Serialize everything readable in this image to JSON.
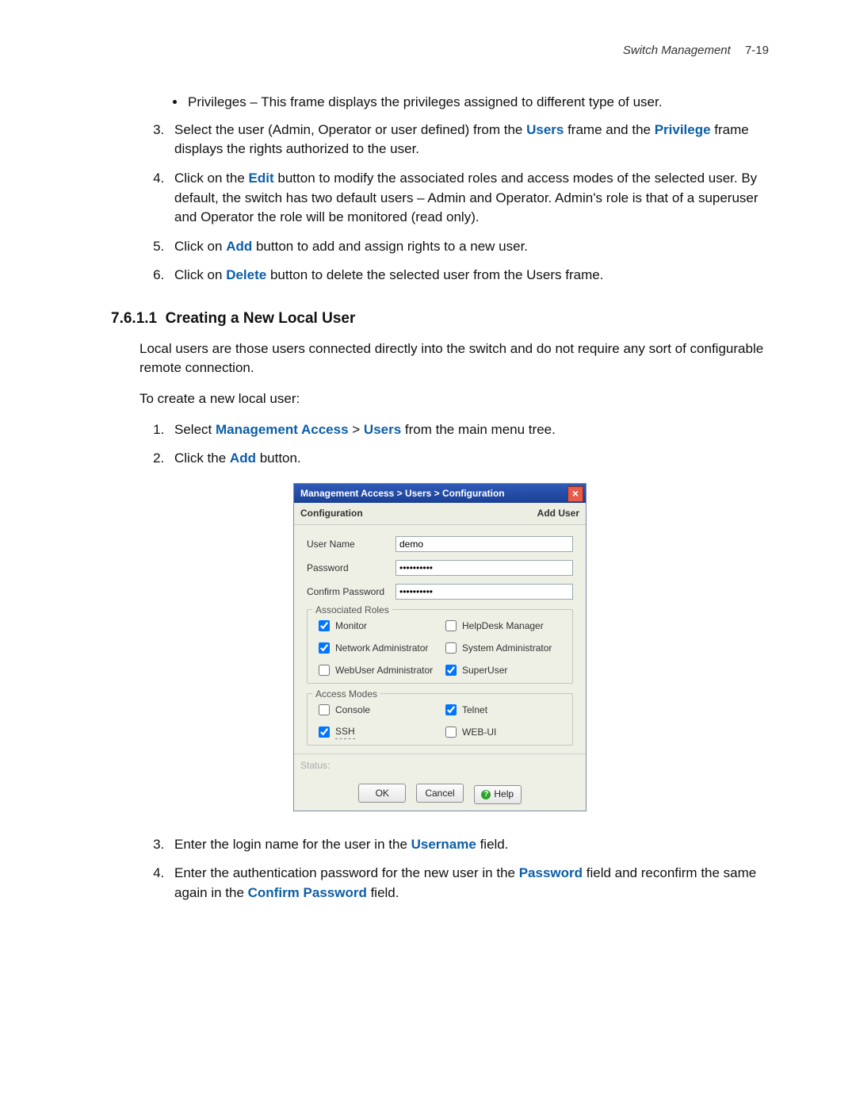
{
  "header": {
    "chapter": "Switch Management",
    "page": "7-19"
  },
  "bullets": [
    "Privileges – This frame displays the privileges assigned to different type of user."
  ],
  "topSteps": {
    "start": 3,
    "items": [
      {
        "pre": "Select the user (Admin, Operator or user defined) from the ",
        "b1": "Users",
        "mid": " frame and the ",
        "b2": "Privilege",
        "post": " frame displays the rights authorized to the user."
      },
      {
        "pre": "Click on the ",
        "b1": "Edit",
        "post": " button to modify the associated roles and access modes of the selected user. By default, the switch has two default users – Admin and Operator. Admin's role is that of a superuser and Operator the role will be monitored (read only)."
      },
      {
        "pre": "Click on ",
        "b1": "Add",
        "post": " button to add and assign rights to a new user."
      },
      {
        "pre": "Click on ",
        "b1": "Delete",
        "post": " button to delete the selected user from the Users frame."
      }
    ]
  },
  "section": {
    "num": "7.6.1.1",
    "title": "Creating a New Local User"
  },
  "intro": "Local users are those users connected directly into the switch and do not require any sort of configurable remote connection.",
  "lead": "To create a new local user:",
  "stepsA": [
    {
      "pre": "Select ",
      "b1": "Management Access",
      "sep": " > ",
      "b2": "Users",
      "post": " from the main menu tree."
    },
    {
      "pre": "Click the ",
      "b1": "Add",
      "post": " button."
    }
  ],
  "dialog": {
    "title": "Management Access > Users > Configuration",
    "tabLeft": "Configuration",
    "tabRight": "Add User",
    "fields": {
      "userLabel": "User Name",
      "userValue": "demo",
      "passLabel": "Password",
      "passValue": "**********",
      "confirmLabel": "Confirm Password",
      "confirmValue": "**********"
    },
    "roles": {
      "legend": "Associated Roles",
      "items": [
        {
          "label": "Monitor",
          "checked": true
        },
        {
          "label": "HelpDesk Manager",
          "checked": false
        },
        {
          "label": "Network Administrator",
          "checked": true
        },
        {
          "label": "System Administrator",
          "checked": false
        },
        {
          "label": "WebUser Administrator",
          "checked": false
        },
        {
          "label": "SuperUser",
          "checked": true
        }
      ]
    },
    "modes": {
      "legend": "Access Modes",
      "items": [
        {
          "label": "Console",
          "checked": false,
          "dashed": false
        },
        {
          "label": "Telnet",
          "checked": true,
          "dashed": false
        },
        {
          "label": "SSH",
          "checked": true,
          "dashed": true
        },
        {
          "label": "WEB-UI",
          "checked": false,
          "dashed": false
        }
      ]
    },
    "status": "Status:",
    "buttons": {
      "ok": "OK",
      "cancel": "Cancel",
      "help": "Help"
    }
  },
  "stepsB": {
    "start": 3,
    "items": [
      {
        "pre": "Enter the login name for the user in the ",
        "b1": "Username",
        "post": " field."
      },
      {
        "pre": "Enter the authentication password for the new user in the ",
        "b1": "Password",
        "mid": " field and reconfirm the same again in the ",
        "b2": "Confirm Password",
        "post": " field."
      }
    ]
  }
}
